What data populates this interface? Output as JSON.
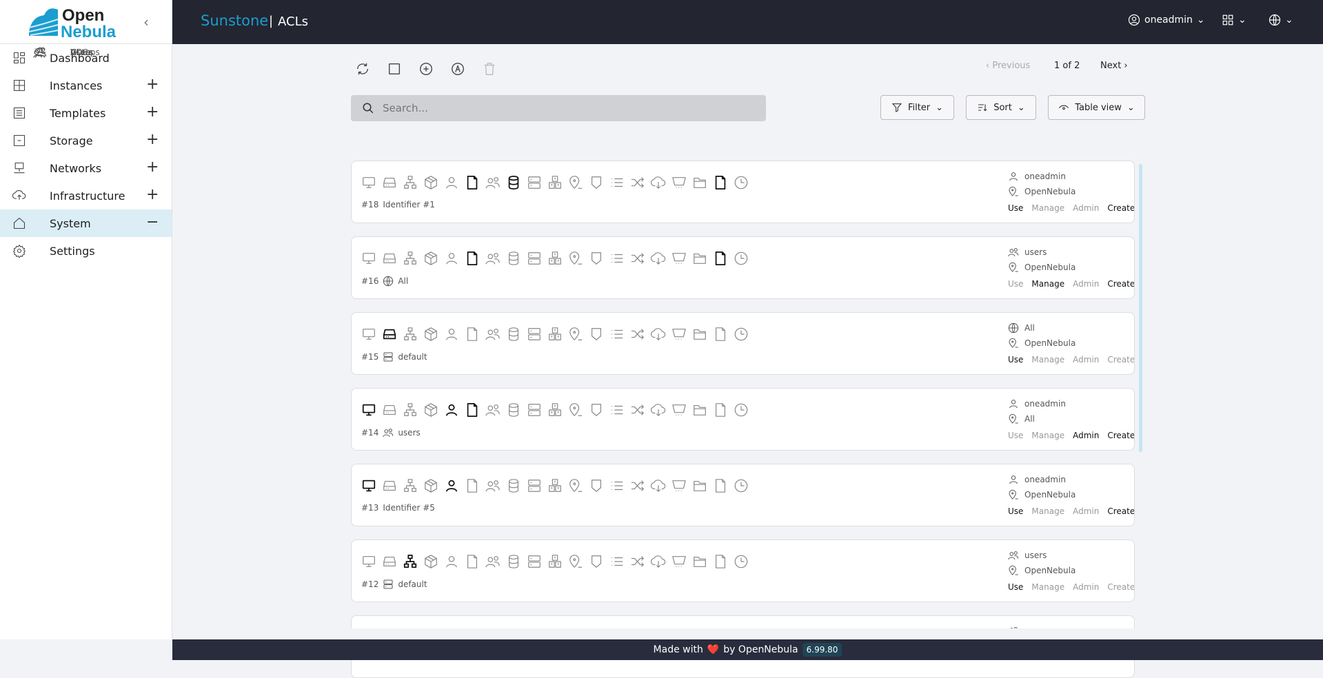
{
  "brand": {
    "logo_text_1": "Open",
    "logo_text_2": "Nebula",
    "app": "Sunstone",
    "separator": "|",
    "page": "ACLs"
  },
  "header": {
    "user": "oneadmin",
    "apps_icon": "grid-icon",
    "lang_icon": "globe-icon"
  },
  "sidebar": {
    "items": [
      {
        "label": "Dashboard",
        "icon": "dashboard",
        "expand": ""
      },
      {
        "label": "Instances",
        "icon": "instances",
        "expand": "+"
      },
      {
        "label": "Templates",
        "icon": "templates",
        "expand": "+"
      },
      {
        "label": "Storage",
        "icon": "storage",
        "expand": "+"
      },
      {
        "label": "Networks",
        "icon": "networks",
        "expand": "+"
      },
      {
        "label": "Infrastructure",
        "icon": "infrastructure",
        "expand": "+"
      },
      {
        "label": "System",
        "icon": "system",
        "expand": "−",
        "state": "open"
      },
      {
        "label": "Users",
        "icon": "user",
        "sub": true
      },
      {
        "label": "Groups",
        "icon": "group",
        "sub": true
      },
      {
        "label": "VDCs",
        "icon": "list",
        "sub": true
      },
      {
        "label": "ACLs",
        "icon": "key",
        "sub": true,
        "state": "active"
      },
      {
        "label": "Settings",
        "icon": "gear",
        "expand": ""
      }
    ]
  },
  "toolbar": {
    "icons": [
      "refresh",
      "select-all",
      "add",
      "create-from-string",
      "delete"
    ]
  },
  "search": {
    "placeholder": "Search...",
    "value": ""
  },
  "controls": {
    "filter": "Filter",
    "sort": "Sort",
    "view": "Table view"
  },
  "pagination": {
    "previous": "Previous",
    "status": "1 of 2",
    "next": "Next"
  },
  "resource_icons": [
    "vm",
    "host",
    "network",
    "image",
    "user",
    "template",
    "group",
    "datastore",
    "cluster",
    "document",
    "zone",
    "security-group",
    "vdc",
    "vrouter",
    "marketplace-app",
    "marketplace",
    "backup",
    "vm-group",
    "backup-job"
  ],
  "acls": [
    {
      "id": "#18",
      "subject_icon": "",
      "subject": "Identifier #1",
      "active": [
        5,
        7,
        17
      ],
      "user_icon": "user",
      "user": "oneadmin",
      "zone": "OpenNebula",
      "rights": {
        "Use": true,
        "Manage": false,
        "Admin": false,
        "Create": true
      }
    },
    {
      "id": "#16",
      "subject_icon": "globe",
      "subject": "All",
      "active": [
        5,
        17
      ],
      "user_icon": "group",
      "user": "users",
      "zone": "OpenNebula",
      "rights": {
        "Use": false,
        "Manage": true,
        "Admin": false,
        "Create": true
      }
    },
    {
      "id": "#15",
      "subject_icon": "cluster",
      "subject": "default",
      "active": [
        1
      ],
      "user_icon": "globe",
      "user": "All",
      "zone": "OpenNebula",
      "rights": {
        "Use": true,
        "Manage": false,
        "Admin": false,
        "Create": false
      }
    },
    {
      "id": "#14",
      "subject_icon": "group",
      "subject": "users",
      "active": [
        0,
        4,
        5
      ],
      "user_icon": "user",
      "user": "oneadmin",
      "zone": "All",
      "rights": {
        "Use": false,
        "Manage": false,
        "Admin": true,
        "Create": true
      }
    },
    {
      "id": "#13",
      "subject_icon": "",
      "subject": "Identifier #5",
      "active": [
        0,
        4
      ],
      "user_icon": "user",
      "user": "oneadmin",
      "zone": "OpenNebula",
      "rights": {
        "Use": true,
        "Manage": false,
        "Admin": false,
        "Create": true
      }
    },
    {
      "id": "#12",
      "subject_icon": "cluster",
      "subject": "default",
      "active": [
        2
      ],
      "user_icon": "group",
      "user": "users",
      "zone": "OpenNebula",
      "rights": {
        "Use": true,
        "Manage": false,
        "Admin": false,
        "Create": false
      }
    },
    {
      "id": "",
      "subject_icon": "",
      "subject": "",
      "active": [],
      "user_icon": "group",
      "user": "",
      "zone": "",
      "rights": {}
    }
  ],
  "footer": {
    "made_with": "Made with",
    "heart": "❤️",
    "by": "by OpenNebula",
    "version": "6.99.80"
  },
  "colors": {
    "accent": "#1a9ed0",
    "header_bg": "#232530",
    "footer_bg": "#292c3c",
    "active_nav": "#8ecfe8",
    "open_nav": "#dbeef6"
  }
}
